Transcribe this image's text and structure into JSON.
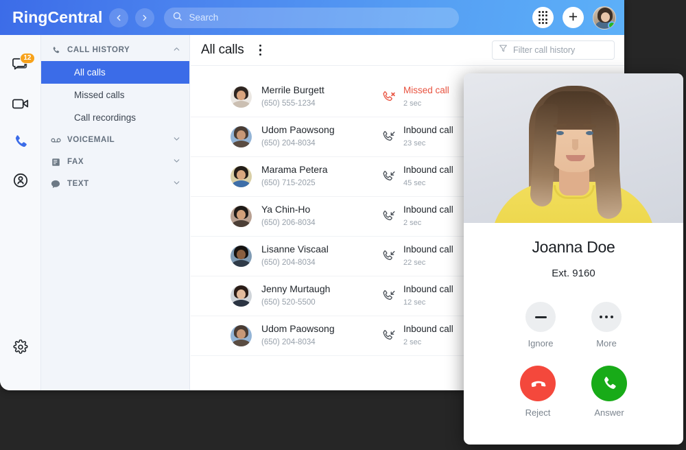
{
  "app": {
    "brand": "RingCentral",
    "nav_back_icon": "chevron-left-icon",
    "nav_forward_icon": "chevron-right-icon",
    "search": {
      "placeholder": "Search",
      "icon": "search-icon"
    },
    "header_actions": {
      "dialpad_icon": "dialpad-icon",
      "add_icon": "plus-icon",
      "avatar_icon": "user-avatar",
      "presence_status": "available",
      "presence_color": "#23b723"
    },
    "accent_color": "#3b6ce8",
    "header_gradient_from": "#3c6ce8",
    "header_gradient_to": "#5cb0f8"
  },
  "icon_rail": {
    "items": [
      {
        "name": "messages",
        "icon": "message-bubble-icon",
        "badge": "12",
        "active": false
      },
      {
        "name": "video",
        "icon": "video-camera-icon",
        "badge": null,
        "active": false
      },
      {
        "name": "phone",
        "icon": "phone-icon",
        "badge": null,
        "active": true
      },
      {
        "name": "contacts",
        "icon": "contacts-icon",
        "badge": null,
        "active": false
      }
    ],
    "settings": {
      "name": "settings",
      "icon": "gear-icon"
    },
    "badge_color": "#f7a21b"
  },
  "sidebar": {
    "sections": [
      {
        "label": "CALL HISTORY",
        "icon": "phone-icon",
        "expanded": true,
        "chevron": "chevron-up-icon",
        "items": [
          {
            "label": "All calls",
            "active": true
          },
          {
            "label": "Missed calls",
            "active": false
          },
          {
            "label": "Call recordings",
            "active": false
          }
        ]
      },
      {
        "label": "VOICEMAIL",
        "icon": "voicemail-icon",
        "expanded": false,
        "chevron": "chevron-down-icon",
        "items": []
      },
      {
        "label": "FAX",
        "icon": "fax-icon",
        "expanded": false,
        "chevron": "chevron-down-icon",
        "items": []
      },
      {
        "label": "TEXT",
        "icon": "text-bubble-icon",
        "expanded": false,
        "chevron": "chevron-down-icon",
        "items": []
      }
    ]
  },
  "main": {
    "title": "All calls",
    "kebab_icon": "more-vertical-icon",
    "filter": {
      "placeholder": "Filter call history",
      "icon": "filter-icon"
    },
    "missed_color": "#e8523f",
    "rows": [
      {
        "name": "Merrile Burgett",
        "phone": "(650) 555-1234",
        "type": "Missed call",
        "duration": "2 sec",
        "icon": "phone-missed-icon",
        "missed": true,
        "avatar": {
          "hair": "#2e2520",
          "face": "#d9a47e",
          "body": "#cbbfb2",
          "bg": "#ebe7e2"
        }
      },
      {
        "name": "Udom Paowsong",
        "phone": "(650) 204-8034",
        "type": "Inbound call",
        "duration": "23 sec",
        "icon": "phone-inbound-icon",
        "missed": false,
        "avatar": {
          "hair": "#4a3c33",
          "face": "#c89877",
          "body": "#5a4c42",
          "bg": "#93b4d6"
        }
      },
      {
        "name": "Marama Petera",
        "phone": "(650) 715-2025",
        "type": "Inbound call",
        "duration": "45 sec",
        "icon": "phone-inbound-icon",
        "missed": false,
        "avatar": {
          "hair": "#231d18",
          "face": "#d8a77f",
          "body": "#3e6ea8",
          "bg": "#d9cfa6"
        }
      },
      {
        "name": "Ya Chin-Ho",
        "phone": "(650) 206-8034",
        "type": "Inbound call",
        "duration": "2 sec",
        "icon": "phone-inbound-icon",
        "missed": false,
        "avatar": {
          "hair": "#1e1a17",
          "face": "#d2a07a",
          "body": "#4c3f36",
          "bg": "#b8a091"
        }
      },
      {
        "name": "Lisanne Viscaal",
        "phone": "(650) 204-8034",
        "type": "Inbound call",
        "duration": "22 sec",
        "icon": "phone-inbound-icon",
        "missed": false,
        "avatar": {
          "hair": "#151210",
          "face": "#8a5f40",
          "body": "#2f3b48",
          "bg": "#7f9bb4"
        }
      },
      {
        "name": "Jenny Murtaugh",
        "phone": "(650) 520-5500",
        "type": "Inbound call",
        "duration": "12 sec",
        "icon": "phone-inbound-icon",
        "missed": false,
        "avatar": {
          "hair": "#2a1c16",
          "face": "#e3bb9c",
          "body": "#2b3442",
          "bg": "#cfd4d9"
        }
      },
      {
        "name": "Udom Paowsong",
        "phone": "(650) 204-8034",
        "type": "Inbound call",
        "duration": "2 sec",
        "icon": "phone-inbound-icon",
        "missed": false,
        "avatar": {
          "hair": "#4a3c33",
          "face": "#c89877",
          "body": "#5a4c42",
          "bg": "#93b4d6"
        }
      }
    ]
  },
  "call_popup": {
    "photo_alt": "caller-photo",
    "caller_name": "Joanna Doe",
    "caller_ext": "Ext. 9160",
    "buttons": [
      {
        "id": "ignore",
        "label": "Ignore",
        "icon": "minus-icon",
        "style": "soft"
      },
      {
        "id": "more",
        "label": "More",
        "icon": "more-horizontal-icon",
        "style": "soft"
      },
      {
        "id": "reject",
        "label": "Reject",
        "icon": "phone-hangup-icon",
        "style": "reject",
        "color": "#f4483c"
      },
      {
        "id": "answer",
        "label": "Answer",
        "icon": "phone-icon",
        "style": "answer",
        "color": "#18ab18"
      }
    ]
  }
}
